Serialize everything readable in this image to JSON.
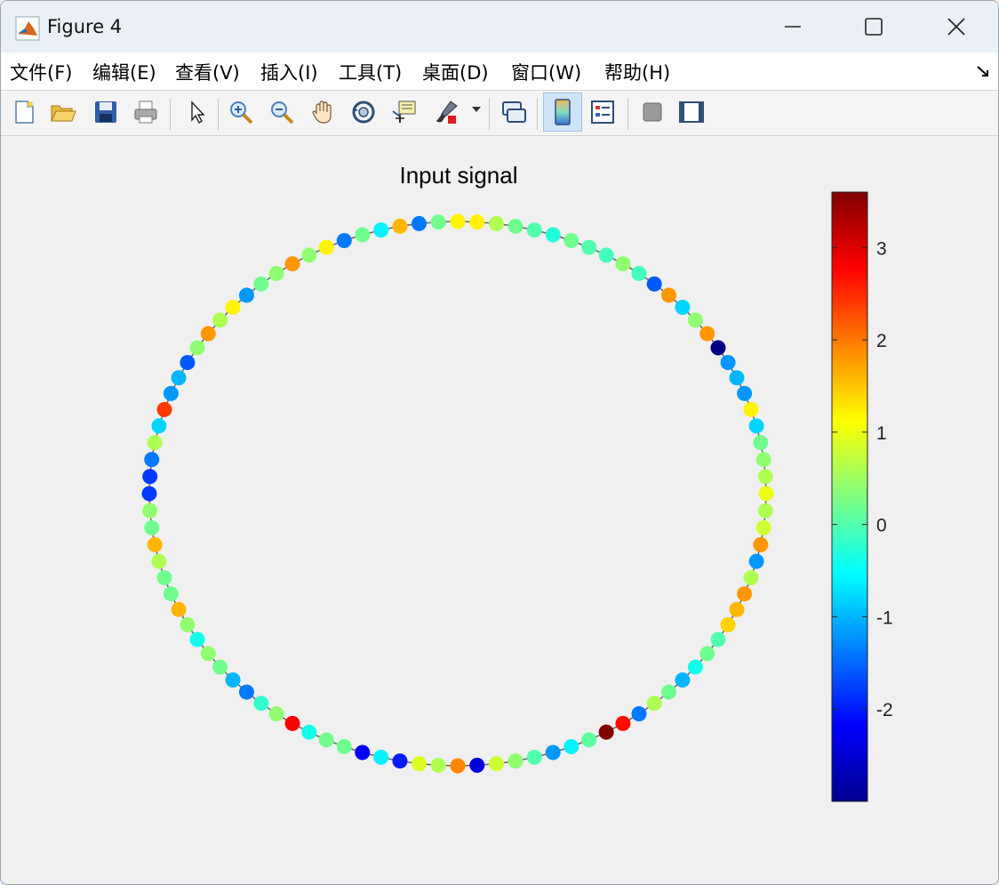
{
  "window": {
    "title": "Figure 4"
  },
  "menu": {
    "items": [
      "文件(F)",
      "编辑(E)",
      "查看(V)",
      "插入(I)",
      "工具(T)",
      "桌面(D)",
      "窗口(W)",
      "帮助(H)"
    ]
  },
  "toolbar": {
    "icons": [
      "new-figure-icon",
      "open-file-icon",
      "save-icon",
      "print-icon",
      "pointer-icon",
      "zoom-in-icon",
      "zoom-out-icon",
      "pan-hand-icon",
      "rotate-3d-icon",
      "data-cursor-icon",
      "brush-icon",
      "link-plot-icon",
      "colorbar-icon",
      "legend-icon",
      "hide-plot-tools-icon",
      "show-plot-tools-icon"
    ]
  },
  "colors": {
    "titlebar": "#eaf0f5",
    "figure_bg": "#f0f0f0",
    "edge": "#666666"
  },
  "chart_data": {
    "type": "scatter",
    "title": "Input signal",
    "layout": "ring graph",
    "node_count": 100,
    "colormap": "jet",
    "clim": [
      -3,
      3.6
    ],
    "colorbar_ticks": [
      -2,
      -1,
      0,
      1,
      2,
      3
    ],
    "colorbar_tick_labels": [
      "-2",
      "-1",
      "0",
      "1",
      "2",
      "3"
    ],
    "values": [
      1.2,
      1.2,
      0.6,
      0.2,
      0.0,
      -0.3,
      0.2,
      0.0,
      -0.1,
      0.4,
      -0.1,
      -1.6,
      1.8,
      -0.8,
      0.4,
      1.8,
      -3.0,
      -1.2,
      -1.0,
      -1.2,
      1.2,
      -0.8,
      0.2,
      0.4,
      0.6,
      1.0,
      0.6,
      0.8,
      1.8,
      -1.2,
      0.6,
      1.8,
      1.6,
      1.4,
      0.0,
      0.2,
      -0.4,
      -1.0,
      0.2,
      0.6,
      -1.4,
      2.7,
      3.6,
      0.1,
      -0.6,
      -1.2,
      0.0,
      0.4,
      0.8,
      -2.4,
      1.9,
      0.6,
      0.9,
      -2.0,
      -0.6,
      -2.2,
      0.2,
      0.2,
      -0.4,
      2.8,
      0.4,
      -0.2,
      -1.4,
      -1.0,
      0.2,
      0.4,
      -0.4,
      0.4,
      1.6,
      0.2,
      0.2,
      0.6,
      1.6,
      0.2,
      0.4,
      -1.8,
      -1.8,
      -1.4,
      0.6,
      -0.8,
      2.4,
      -1.2,
      -1.0,
      -1.6,
      0.4,
      1.8,
      0.6,
      1.2,
      -1.2,
      0.2,
      0.4,
      1.8,
      0.4,
      1.2,
      -1.4,
      0.2,
      -0.6,
      1.6,
      -1.4,
      0.2
    ]
  }
}
